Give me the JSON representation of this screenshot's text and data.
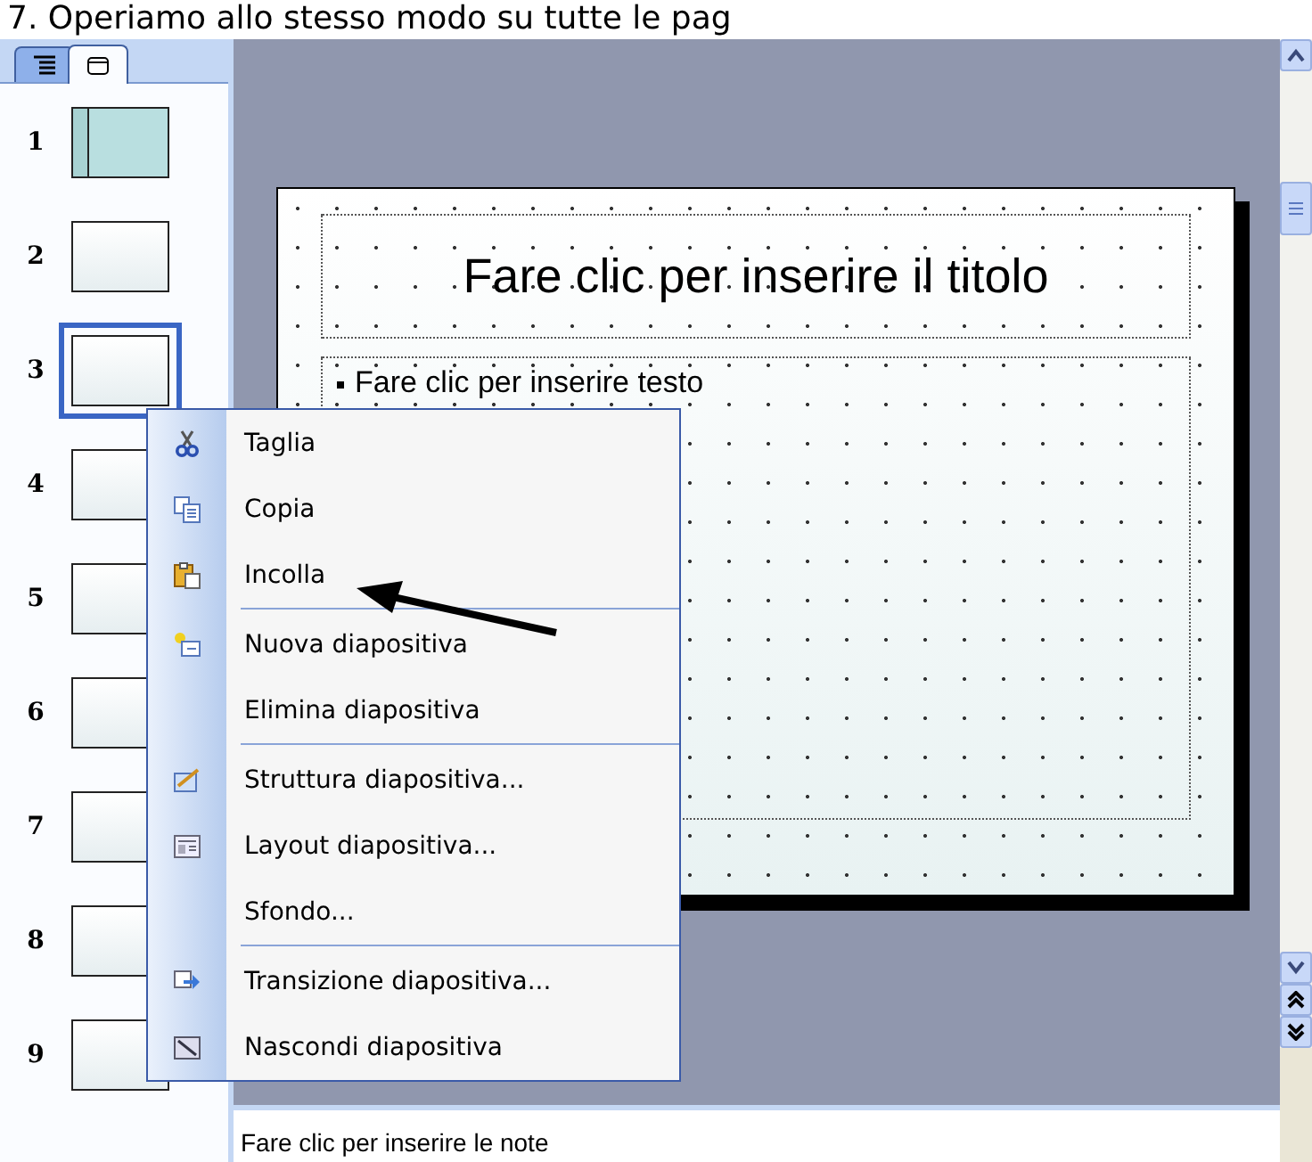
{
  "caption": "7. Operiamo allo stesso modo su tutte le pag",
  "tabs": [
    {
      "selected": false
    },
    {
      "selected": true
    }
  ],
  "slides": [
    {
      "number": "1",
      "kind": "title",
      "selected": false
    },
    {
      "number": "2",
      "kind": "blank",
      "selected": false
    },
    {
      "number": "3",
      "kind": "blank",
      "selected": true
    },
    {
      "number": "4",
      "kind": "blank",
      "selected": false
    },
    {
      "number": "5",
      "kind": "blank",
      "selected": false
    },
    {
      "number": "6",
      "kind": "blank",
      "selected": false
    },
    {
      "number": "7",
      "kind": "blank",
      "selected": false
    },
    {
      "number": "8",
      "kind": "blank",
      "selected": false
    },
    {
      "number": "9",
      "kind": "blank",
      "selected": false
    }
  ],
  "slide": {
    "title_placeholder": "Fare clic per inserire il titolo",
    "body_placeholder": "Fare clic per inserire testo"
  },
  "notes": {
    "placeholder": "Fare clic per inserire le note"
  },
  "context_menu": [
    {
      "kind": "item",
      "label": "Taglia"
    },
    {
      "kind": "item",
      "label": "Copia"
    },
    {
      "kind": "item",
      "label": "Incolla"
    },
    {
      "kind": "separator"
    },
    {
      "kind": "item",
      "label": "Nuova diapositiva"
    },
    {
      "kind": "item",
      "label": "Elimina diapositiva"
    },
    {
      "kind": "separator"
    },
    {
      "kind": "item",
      "label": "Struttura diapositiva..."
    },
    {
      "kind": "item",
      "label": "Layout diapositiva..."
    },
    {
      "kind": "item",
      "label": "Sfondo..."
    },
    {
      "kind": "separator"
    },
    {
      "kind": "item",
      "label": "Transizione diapositiva..."
    },
    {
      "kind": "item",
      "label": "Nascondi diapositiva"
    }
  ]
}
